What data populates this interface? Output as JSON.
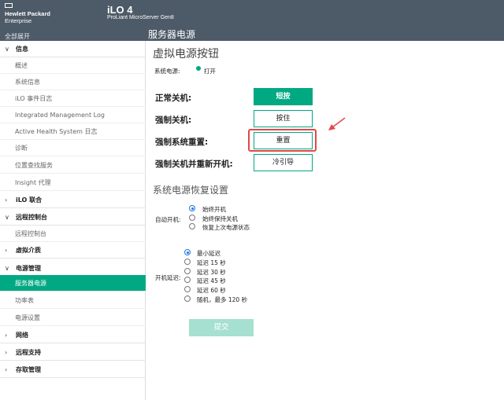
{
  "topbar": {
    "brand_line1": "Hewlett Packard",
    "brand_line2": "Enterprise",
    "expand_all": "全部展开",
    "app_title": "iLO 4",
    "app_subtitle": "ProLiant MicroServer Gen8",
    "page_heading": "服务器电源"
  },
  "sidebar": {
    "sections": [
      {
        "label": "信息",
        "chevron": "∨"
      },
      {
        "label": "iLO 联合",
        "chevron": "›"
      },
      {
        "label": "远程控制台",
        "chevron": "∨"
      },
      {
        "label": "虚拟介质",
        "chevron": "›"
      },
      {
        "label": "电源管理",
        "chevron": "∨"
      },
      {
        "label": "网络",
        "chevron": "›"
      },
      {
        "label": "远程支持",
        "chevron": "›"
      },
      {
        "label": "存取管理",
        "chevron": "›"
      }
    ],
    "items": [
      {
        "label": "概述"
      },
      {
        "label": "系统信息"
      },
      {
        "label": "iLO 事件日志"
      },
      {
        "label": "Integrated Management Log"
      },
      {
        "label": "Active Health System 日志"
      },
      {
        "label": "诊断"
      },
      {
        "label": "位置查找服务"
      },
      {
        "label": "Insight 代理"
      },
      {
        "label": "远程控制台"
      },
      {
        "label": "服务器电源"
      },
      {
        "label": "功率表"
      },
      {
        "label": "电源设置"
      }
    ]
  },
  "virtual_power": {
    "heading": "虚拟电源按钮",
    "system_power_label": "系统电源:",
    "system_power_status": "打开",
    "status_color": "#01a982",
    "rows": [
      {
        "label": "正常关机:",
        "button": "短按"
      },
      {
        "label": "强制关机:",
        "button": "按住"
      },
      {
        "label": "强制系统重置:",
        "button": "重置"
      },
      {
        "label": "强制关机并重新开机:",
        "button": "冷引导"
      }
    ]
  },
  "recovery": {
    "heading": "系统电源恢复设置",
    "auto_on_label": "自动开机:",
    "auto_on_options": [
      "始终开机",
      "始终保持关机",
      "恢复上次电源状态"
    ],
    "auto_on_selected": "始终开机",
    "delay_label": "开机延迟:",
    "delay_options": [
      "最小延迟",
      "延迟 15 秒",
      "延迟 30 秒",
      "延迟 45 秒",
      "延迟 60 秒",
      "随机，最多 120 秒"
    ],
    "delay_selected": "最小延迟",
    "submit_label": "提交"
  },
  "colors": {
    "accent": "#01a982",
    "topbar": "#4d5a67",
    "annotation": "#e34848"
  }
}
